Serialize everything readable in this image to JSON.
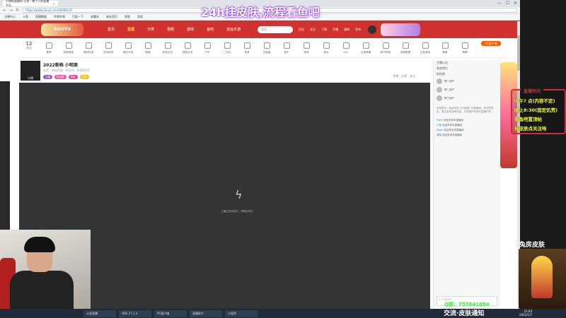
{
  "overlay": {
    "title": "24h挂皮肤,流程看鱼吧",
    "room_label": "兔房皮肤",
    "qq": "Q群：757841094",
    "ticker": "交流·皮肤通知",
    "schedule_title": "直播时间",
    "schedule_lines": [
      "中午? 点(内容不定)",
      "晚上8:30(固定饥荒)",
      "看鱼吧置顶帖",
      "挂皮肤点关注哈"
    ]
  },
  "browser": {
    "tab_label": "小明的直播间 斗鱼 - 每个人的直播平台",
    "url": "https://www.douyu.com/6068147",
    "bookmarks": [
      "主播中心",
      "斗鱼",
      "直播数据",
      "哔哩哔哩",
      "百度一下",
      "收藏夹",
      "新标签页",
      "视频",
      "游戏"
    ],
    "window_controls": [
      "—",
      "☐",
      "✕"
    ]
  },
  "header": {
    "logo": "DOUYU",
    "nav": [
      "首页",
      "直播",
      "分类",
      "视频",
      "游戏",
      "鱼吧",
      "亚运手游"
    ],
    "active_nav": "直播",
    "search_placeholder": "搜索",
    "icons": [
      "历史",
      "关注",
      "下载",
      "开播",
      "通知",
      "发布"
    ]
  },
  "categories": {
    "follow_count": "12",
    "follow_label": "关注",
    "items": [
      "推荐",
      "网游竞技",
      "单机热游",
      "手游休闲",
      "娱乐天地",
      "颜值",
      "科技文化",
      "语音互动",
      "户外",
      "二次元",
      "体育",
      "正能量",
      "音乐",
      "游戏",
      "综合",
      "LOL",
      "王者荣耀",
      "和平精英",
      "英雄联盟",
      "主机游戏",
      "赛事",
      "棋牌",
      "更多",
      "全部分类"
    ],
    "pc_button": "PC客户端"
  },
  "streamer": {
    "avatar_text": "小明",
    "title": "2022新档 小明酒",
    "meta": "饥荒 · 单机热游 · 房间号：6068147",
    "badges": [
      {
        "text": "主播",
        "color": "#9b59b6"
      },
      {
        "text": "粉丝牌",
        "color": "#ff4fa3"
      },
      {
        "text": "等级",
        "color": "#e84393"
      },
      {
        "text": "活动",
        "color": "#f1c40f"
      }
    ],
    "report": "举报 · 分享 · 关注"
  },
  "video": {
    "message": "主播正在休息中，请稍后再试"
  },
  "chat": {
    "tabs": [
      "主播公告",
      "贵宾席位",
      "粉丝榜"
    ],
    "rank": [
      "榜一用户",
      "榜二用户",
      "榜三用户"
    ],
    "notice": "系统提示：欢迎来到【小明酒】的直播间，请文明发言，禁止发布违规内容，共同维护良好的直播环境。",
    "lines": [
      {
        "user": "Truth",
        "text": "欢迎来到本直播间"
      },
      {
        "user": "小鱼",
        "text": "欢迎来到本直播间"
      },
      {
        "user": "Moon",
        "text": "欢迎来到本直播间"
      },
      {
        "user": "咸鱼",
        "text": "欢迎来到本直播间"
      }
    ],
    "input_placeholder": "发个弹幕吧~"
  },
  "taskbar": {
    "items": [
      "斗鱼直播",
      "OBS 27.1.3",
      "PC客户端",
      "直播助手",
      "小程序"
    ],
    "time": "21:03",
    "date": "2022/1/7"
  },
  "colors": {
    "brand": "#d1312f",
    "overlay_yellow": "#f3ff2b",
    "schedule_border": "#d7263d"
  }
}
